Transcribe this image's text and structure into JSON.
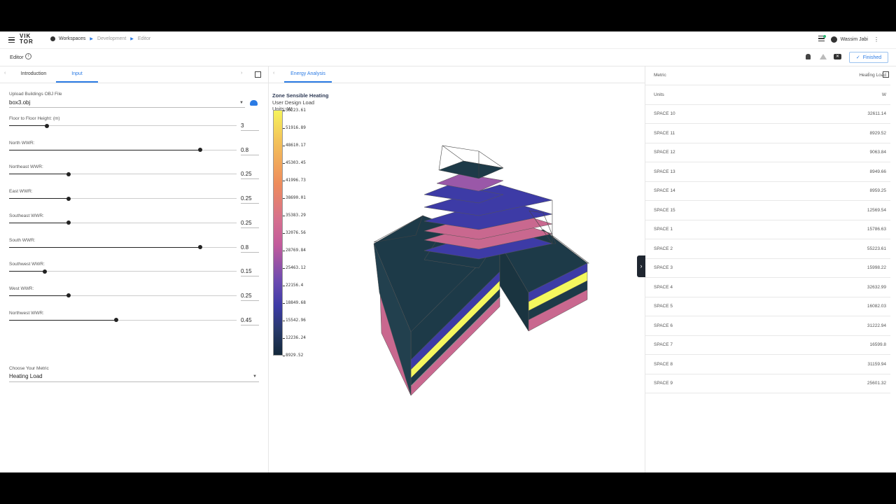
{
  "header": {
    "logo_top": "VIK",
    "logo_bottom": "TOR",
    "breadcrumbs": [
      "Workspaces",
      "Development",
      "Editor"
    ],
    "user_name": "Wassim Jabi"
  },
  "editor": {
    "title": "Editor",
    "status_label": "Finished"
  },
  "left_panel": {
    "tabs": [
      "Introduction",
      "Input"
    ],
    "active_tab": "Input",
    "upload_label": "Upload Buildings OBJ File",
    "upload_value": "box3.obj",
    "sliders": [
      {
        "label": "Floor to Floor Height: (m)",
        "value": "3",
        "fraction": 0.165
      },
      {
        "label": "North WWR:",
        "value": "0.8",
        "fraction": 0.84
      },
      {
        "label": "Northeast WWR:",
        "value": "0.25",
        "fraction": 0.26
      },
      {
        "label": "East WWR:",
        "value": "0.25",
        "fraction": 0.26
      },
      {
        "label": "Southeast WWR:",
        "value": "0.25",
        "fraction": 0.26
      },
      {
        "label": "South WWR:",
        "value": "0.8",
        "fraction": 0.84
      },
      {
        "label": "Southwest WWR:",
        "value": "0.15",
        "fraction": 0.157
      },
      {
        "label": "West WWR:",
        "value": "0.25",
        "fraction": 0.26
      },
      {
        "label": "Northwest WWR:",
        "value": "0.45",
        "fraction": 0.47
      }
    ],
    "metric_label": "Choose Your Metric",
    "metric_value": "Heating Load"
  },
  "mid_panel": {
    "tab": "Energy Analysis",
    "legend_title": "Zone Sensible Heating",
    "legend_subtitle": "User Design Load",
    "legend_units": "Units: W",
    "legend_ticks": [
      "55223.61",
      "51916.89",
      "48610.17",
      "45303.45",
      "41996.73",
      "38690.01",
      "35383.29",
      "32076.56",
      "28769.84",
      "25463.12",
      "22156.4",
      "18849.68",
      "15542.96",
      "12236.24",
      "8929.52"
    ]
  },
  "right_panel": {
    "header_key": "Metric",
    "header_value": "Heating Load",
    "units_key": "Units",
    "units_value": "W",
    "rows": [
      {
        "k": "SPACE 10",
        "v": "32611.14"
      },
      {
        "k": "SPACE 11",
        "v": "8929.52"
      },
      {
        "k": "SPACE 12",
        "v": "9063.84"
      },
      {
        "k": "SPACE 13",
        "v": "8949.66"
      },
      {
        "k": "SPACE 14",
        "v": "8959.25"
      },
      {
        "k": "SPACE 15",
        "v": "12569.54"
      },
      {
        "k": "SPACE 1",
        "v": "15786.63"
      },
      {
        "k": "SPACE 2",
        "v": "55223.61"
      },
      {
        "k": "SPACE 3",
        "v": "15998.22"
      },
      {
        "k": "SPACE 4",
        "v": "32632.99"
      },
      {
        "k": "SPACE 5",
        "v": "16082.03"
      },
      {
        "k": "SPACE 6",
        "v": "31222.94"
      },
      {
        "k": "SPACE 7",
        "v": "16599.8"
      },
      {
        "k": "SPACE 8",
        "v": "31159.94"
      },
      {
        "k": "SPACE 9",
        "v": "25601.32"
      }
    ]
  },
  "colors": {
    "accent": "#2b7be4",
    "dark_slab": "#1d3a48",
    "blue_slab": "#3d3ba6",
    "pink_slab": "#c9688f",
    "yellow_slab": "#f4f75e",
    "purple_slab": "#9a58a8"
  }
}
